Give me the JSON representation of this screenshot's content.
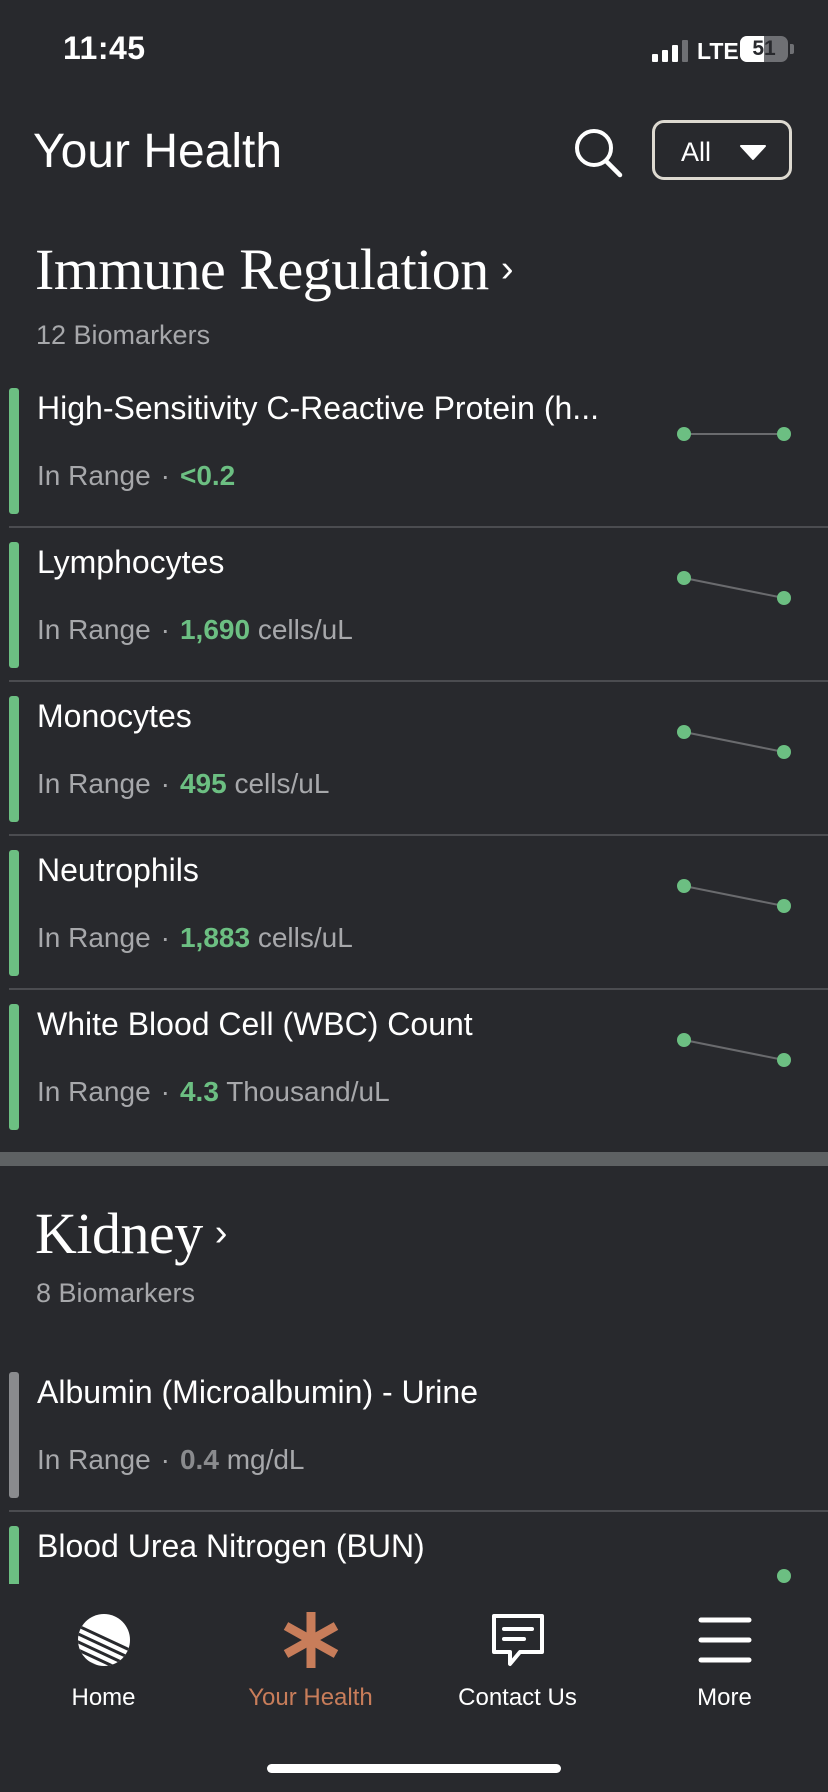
{
  "status_bar": {
    "time": "11:45",
    "network": "LTE",
    "battery": "51"
  },
  "header": {
    "title": "Your Health",
    "filter_label": "All"
  },
  "colors": {
    "in_range": "#6cbf82",
    "neutral": "#8a8b8e",
    "accent": "#c87d5a"
  },
  "sections": [
    {
      "title": "Immune Regulation",
      "count": "12 Biomarkers",
      "items": [
        {
          "name": "High-Sensitivity C-Reactive Protein (h...",
          "status": "In Range",
          "value": "<0.2",
          "unit": ""
        },
        {
          "name": "Lymphocytes",
          "status": "In Range",
          "value": "1,690",
          "unit": "cells/uL"
        },
        {
          "name": "Monocytes",
          "status": "In Range",
          "value": "495",
          "unit": "cells/uL"
        },
        {
          "name": "Neutrophils",
          "status": "In Range",
          "value": "1,883",
          "unit": "cells/uL"
        },
        {
          "name": "White Blood Cell (WBC) Count",
          "status": "In Range",
          "value": "4.3",
          "unit": "Thousand/uL"
        }
      ]
    },
    {
      "title": "Kidney",
      "count": "8 Biomarkers",
      "items": [
        {
          "name": "Albumin (Microalbumin) - Urine",
          "status": "In Range",
          "value": "0.4",
          "unit": "mg/dL"
        },
        {
          "name": "Blood Urea Nitrogen (BUN)",
          "status": "",
          "value": "",
          "unit": ""
        }
      ]
    }
  ],
  "tabbar": {
    "home": "Home",
    "your_health": "Your Health",
    "contact_us": "Contact Us",
    "more": "More"
  }
}
